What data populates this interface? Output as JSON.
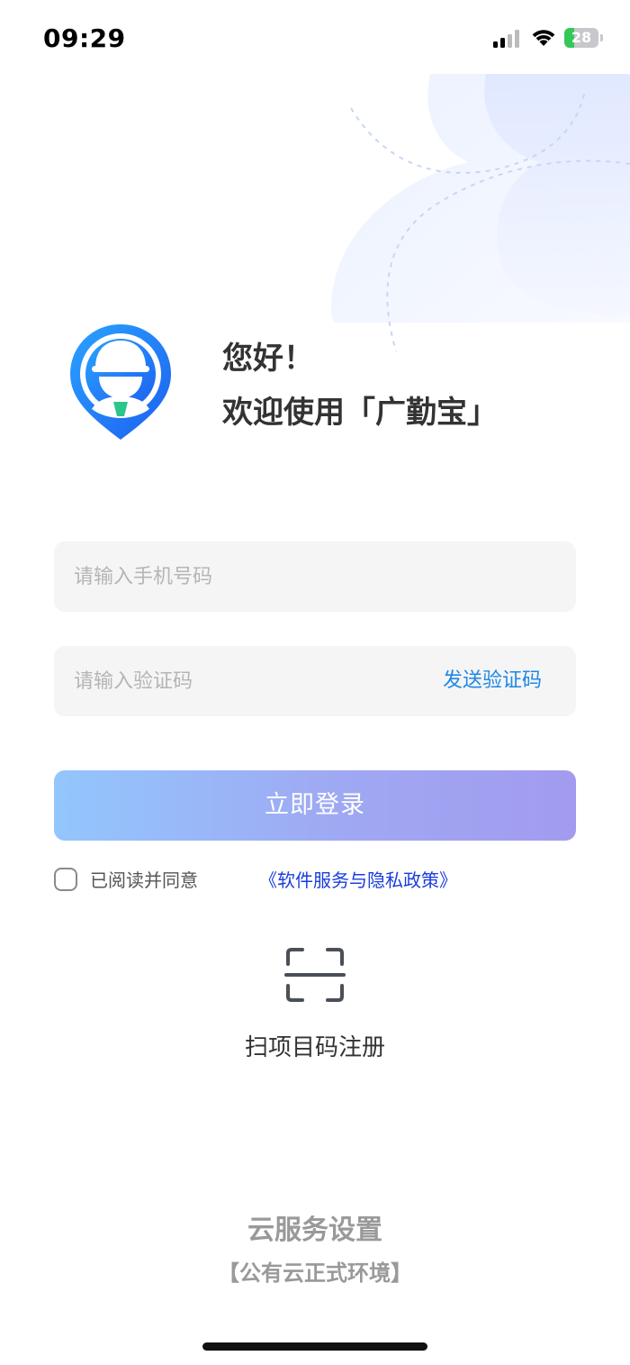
{
  "status_bar": {
    "time": "09:29",
    "battery": "28",
    "battery_level": 0.28
  },
  "header": {
    "greeting": "您好！",
    "welcome": "欢迎使用「广勤宝」"
  },
  "form": {
    "phone_placeholder": "请输入手机号码",
    "phone_value": "",
    "code_placeholder": "请输入验证码",
    "code_value": "",
    "send_code_label": "发送验证码",
    "login_label": "立即登录"
  },
  "agreement": {
    "checked": false,
    "text": "已阅读并同意",
    "policy_link": "《软件服务与隐私政策》"
  },
  "scan": {
    "label": "扫项目码注册"
  },
  "cloud": {
    "title": "云服务设置",
    "environment": "【公有云正式环境】"
  },
  "colors": {
    "accent_blue": "#1e88e5",
    "link_blue": "#1a3ddb",
    "button_gradient_start": "#93c6fd",
    "button_gradient_end": "#a29bef",
    "field_bg": "#f5f5f5"
  }
}
